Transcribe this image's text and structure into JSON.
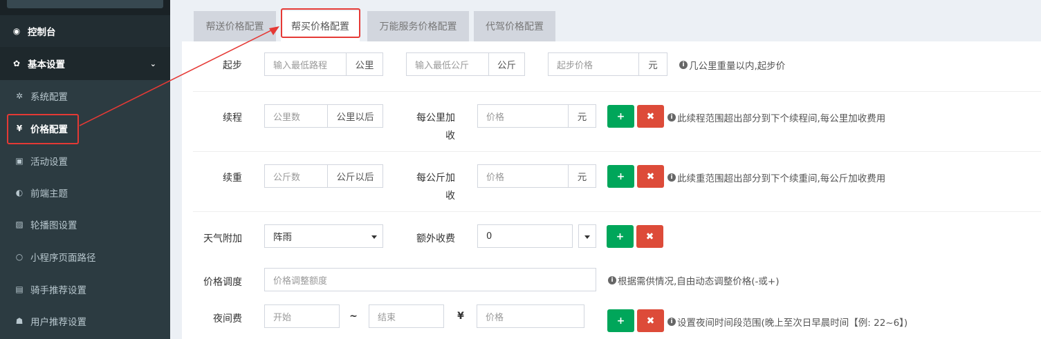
{
  "sidebar": {
    "items": [
      {
        "label": "控制台",
        "icon": "dashboard-icon",
        "glyph": "◉"
      },
      {
        "label": "基本设置",
        "icon": "gear-icon",
        "glyph": "✿"
      },
      {
        "label": "系统配置",
        "icon": "cog-icon",
        "glyph": "✲"
      },
      {
        "label": "价格配置",
        "icon": "yen-icon",
        "glyph": "¥"
      },
      {
        "label": "活动设置",
        "icon": "gift-icon",
        "glyph": "▣"
      },
      {
        "label": "前端主题",
        "icon": "palette-icon",
        "glyph": "◐"
      },
      {
        "label": "轮播图设置",
        "icon": "image-icon",
        "glyph": "▨"
      },
      {
        "label": "小程序页面路径",
        "icon": "circle-icon",
        "glyph": "○"
      },
      {
        "label": "骑手推荐设置",
        "icon": "lock-icon",
        "glyph": "▤"
      },
      {
        "label": "用户推荐设置",
        "icon": "users-icon",
        "glyph": "☗"
      }
    ],
    "chevron": "⌄"
  },
  "tabs": [
    "帮送价格配置",
    "帮买价格配置",
    "万能服务价格配置",
    "代驾价格配置"
  ],
  "form": {
    "start": {
      "label": "起步",
      "min_distance_placeholder": "输入最低路程",
      "distance_unit": "公里",
      "min_weight_placeholder": "输入最低公斤",
      "weight_unit": "公斤",
      "start_price_placeholder": "起步价格",
      "price_unit": "元",
      "help": "几公里重量以内,起步价"
    },
    "distance": {
      "label": "续程",
      "km_placeholder": "公里数",
      "km_addon": "公里以后",
      "per_label_1": "每公里加",
      "per_label_2": "收",
      "price_placeholder": "价格",
      "price_unit": "元",
      "help": "此续程范围超出部分到下个续程间,每公里加收费用"
    },
    "weight": {
      "label": "续重",
      "kg_placeholder": "公斤数",
      "kg_addon": "公斤以后",
      "per_label_1": "每公斤加",
      "per_label_2": "收",
      "price_placeholder": "价格",
      "price_unit": "元",
      "help": "此续重范围超出部分到下个续重间,每公斤加收费用"
    },
    "weather": {
      "label": "天气附加",
      "selected": "阵雨",
      "extra_label": "额外收费",
      "extra_value": "0"
    },
    "adjust": {
      "label": "价格调度",
      "placeholder": "价格调整额度",
      "help": "根据需供情况,自由动态调整价格(-或+)"
    },
    "night": {
      "label": "夜间费",
      "start_placeholder": "开始",
      "tilde": "~",
      "end_placeholder": "结束",
      "yen": "¥",
      "price_placeholder": "价格",
      "help": "设置夜间时间段范围(晚上至次日早晨时间【例: 22~6】)"
    },
    "add_glyph": "+",
    "remove_glyph": "✖",
    "info_glyph": "i"
  },
  "colors": {
    "sidebar_bg": "#222d32",
    "accent_green": "#00a65a",
    "accent_red": "#dd4b39",
    "highlight_red": "#e53935"
  }
}
